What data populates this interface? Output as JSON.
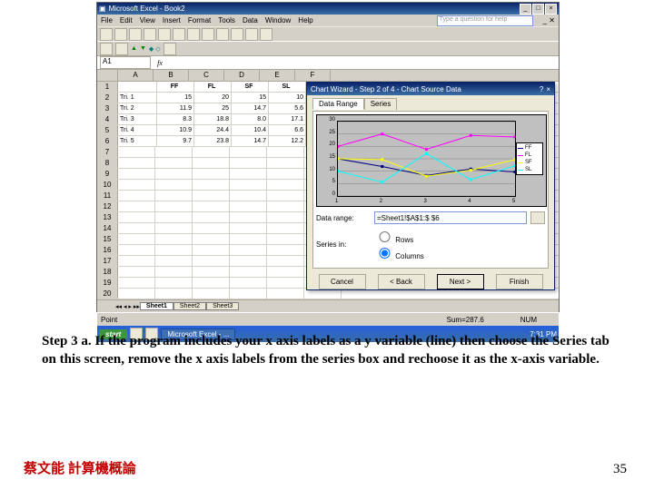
{
  "excel": {
    "app_title": "Microsoft Excel - Book2",
    "menu": [
      "File",
      "Edit",
      "View",
      "Insert",
      "Format",
      "Tools",
      "Data",
      "Window",
      "Help"
    ],
    "ask_placeholder": "Type a question for help",
    "namebox": "A1",
    "fx": "fx",
    "columns": [
      "A",
      "B",
      "C",
      "D",
      "E",
      "F"
    ],
    "data_rows": [
      [
        "",
        "FF",
        "FL",
        "SF",
        "SL"
      ],
      [
        "Tri. 1",
        "15",
        "20",
        "15",
        "10"
      ],
      [
        "Tri. 2",
        "11.9",
        "25",
        "14.7",
        "5.6"
      ],
      [
        "Tri. 3",
        "8.3",
        "18.8",
        "8.0",
        "17.1"
      ],
      [
        "Tri. 4",
        "10.9",
        "24.4",
        "10.4",
        "6.6"
      ],
      [
        "Tri. 5",
        "9.7",
        "23.8",
        "14.7",
        "12.2"
      ]
    ],
    "blank_rows": 19,
    "sheets": [
      "Sheet1",
      "Sheet2",
      "Sheet3"
    ],
    "status_left": "Point",
    "status_sum": "Sum=287.6",
    "status_ind": "NUM"
  },
  "dialog": {
    "title": "Chart Wizard - Step 2 of 4 - Chart Source Data",
    "tabs": [
      "Data Range",
      "Series"
    ],
    "active_tab": 0,
    "data_range_label": "Data range:",
    "data_range_value": "=Sheet1!$A$1:$ $6",
    "series_in_label": "Series in:",
    "radio_rows": "Rows",
    "radio_cols": "Columns",
    "buttons": [
      "Cancel",
      "< Back",
      "Next >",
      "Finish"
    ]
  },
  "chart_data": {
    "type": "line",
    "categories": [
      "1",
      "2",
      "3",
      "4",
      "5"
    ],
    "series": [
      {
        "name": "FF",
        "values": [
          15,
          11.9,
          8.3,
          10.9,
          9.7
        ],
        "color": "#000080"
      },
      {
        "name": "FL",
        "values": [
          20,
          25,
          18.8,
          24.4,
          23.8
        ],
        "color": "#ff00ff"
      },
      {
        "name": "SF",
        "values": [
          15,
          14.7,
          8.0,
          10.4,
          14.7
        ],
        "color": "#ffff00"
      },
      {
        "name": "SL",
        "values": [
          10,
          5.6,
          17.1,
          6.6,
          12.2
        ],
        "color": "#00ffff"
      }
    ],
    "ylim": [
      0,
      30
    ],
    "yticks": [
      0,
      5,
      10,
      15,
      20,
      25,
      30
    ]
  },
  "taskbar": {
    "start": "start",
    "tasks": [
      "Microsoft Excel - ..."
    ],
    "time": "7:31 PM"
  },
  "caption_text": "Step 3 a. If the program includes your x axis labels as a y variable (line) then choose the Series tab on this screen, remove the x axis labels from the series box and rechoose it as the x-axis variable.",
  "footer_left": "蔡文能 計算機概論",
  "footer_right": "35"
}
